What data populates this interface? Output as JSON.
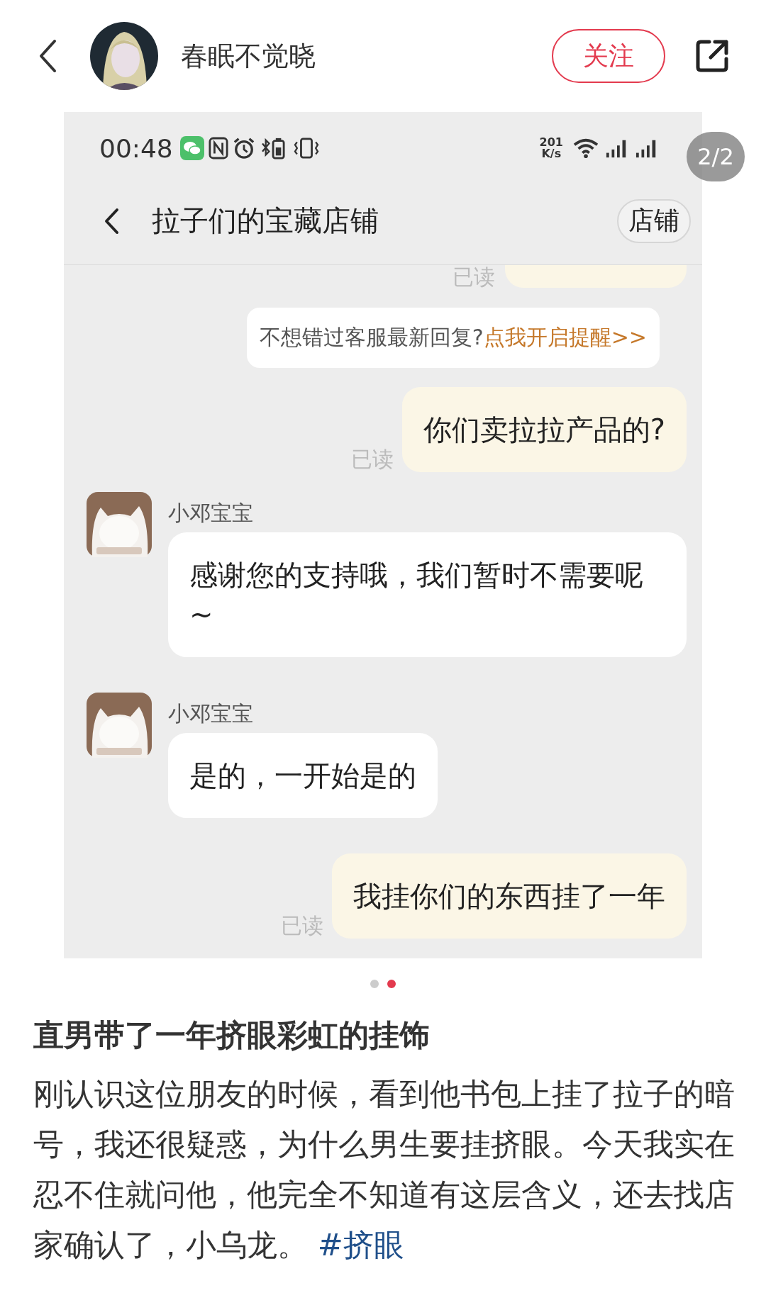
{
  "header": {
    "username": "春眠不觉晓",
    "follow_button": "关注"
  },
  "gallery": {
    "page_indicator": "2/2",
    "dots": [
      {
        "selected": false
      },
      {
        "selected": true
      }
    ],
    "screenshot": {
      "status_bar": {
        "time": "00:48",
        "net_speed_value": "201",
        "net_speed_unit": "K/s"
      },
      "chat_header": {
        "title": "拉子们的宝藏店铺",
        "shop_button": "店铺"
      },
      "messages": [
        {
          "kind": "partial",
          "read_label": "已读"
        },
        {
          "kind": "notice",
          "text": "不想错过客服最新回复?",
          "link": "点我开启提醒>>"
        },
        {
          "kind": "outgoing",
          "text": "你们卖拉拉产品的?",
          "read_label": "已读"
        },
        {
          "kind": "incoming",
          "name": "小邓宝宝",
          "text": "感谢您的支持哦，我们暂时不需要呢~"
        },
        {
          "kind": "incoming",
          "name": "小邓宝宝",
          "text": "是的，一开始是的"
        },
        {
          "kind": "outgoing",
          "text": "我挂你们的东西挂了一年",
          "read_label": "已读"
        }
      ]
    }
  },
  "post": {
    "title": "直男带了一年挤眼彩虹的挂饰",
    "body": "刚认识这位朋友的时候，看到他书包上挂了拉子的暗号，我还很疑惑，为什么男生要挂挤眼。今天我实在忍不住就问他，他完全不知道有这层含义，还去找店家确认了，小乌龙。",
    "hashtag": "#挤眼"
  }
}
